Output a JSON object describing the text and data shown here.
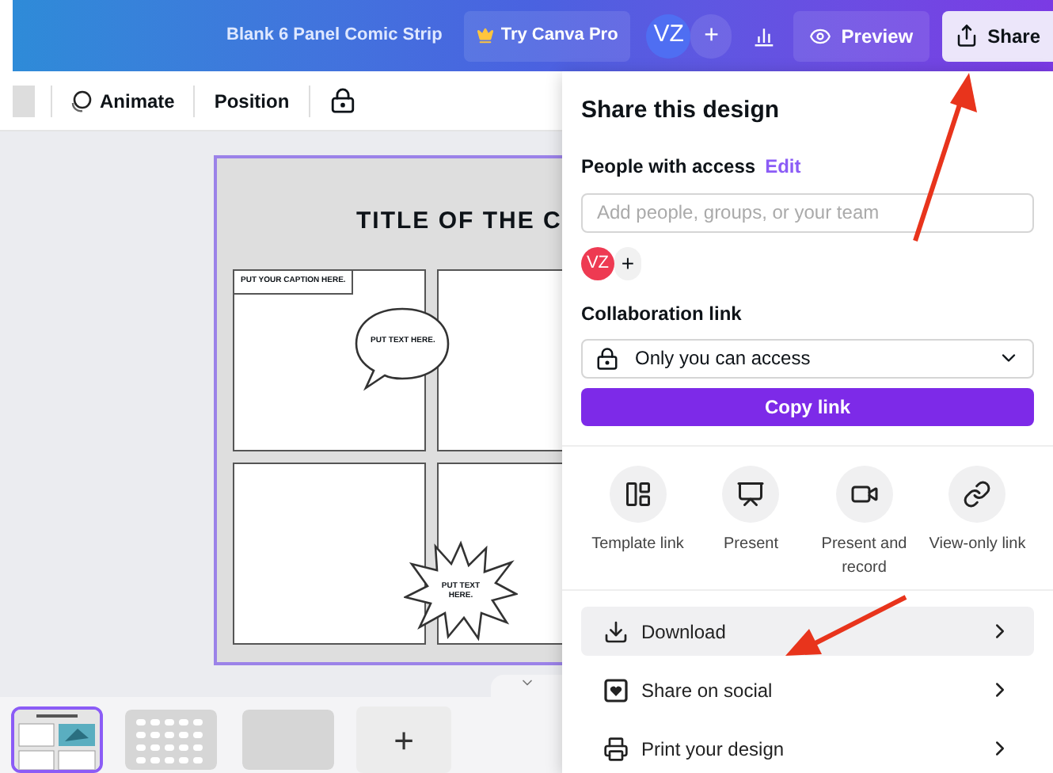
{
  "top_bar": {
    "title": "Blank 6 Panel Comic Strip",
    "pro_button": "Try Canva Pro",
    "avatar": "VZ",
    "add_button": "+",
    "preview_button": "Preview",
    "share_button": "Share"
  },
  "toolbar": {
    "animate_button": "Animate",
    "position_button": "Position"
  },
  "design": {
    "title": "TITLE OF THE C",
    "caption": "PUT YOUR CAPTION HERE.",
    "speech_text": "PUT TEXT HERE.",
    "burst_text": "PUT TEXT HERE."
  },
  "pages": {
    "thumbnails": [
      {
        "kind": "comic",
        "selected": true
      },
      {
        "kind": "dots",
        "selected": false
      },
      {
        "kind": "blank",
        "selected": false
      }
    ],
    "add_button": "+"
  },
  "share_panel": {
    "title": "Share this design",
    "people_label": "People with access",
    "edit_link": "Edit",
    "people_placeholder": "Add people, groups, or your team",
    "member_avatar": "VZ",
    "add_member": "+",
    "collab_label": "Collaboration link",
    "access_option": "Only you can access",
    "copy_button": "Copy link",
    "actions": [
      {
        "kind": "template",
        "label": "Template link"
      },
      {
        "kind": "present",
        "label": "Present"
      },
      {
        "kind": "record",
        "label": "Present and record"
      },
      {
        "kind": "view",
        "label": "View-only link"
      }
    ],
    "rows": [
      {
        "kind": "download",
        "label": "Download",
        "selected": true
      },
      {
        "kind": "social",
        "label": "Share on social",
        "selected": false
      },
      {
        "kind": "print",
        "label": "Print your design",
        "selected": false
      }
    ]
  }
}
